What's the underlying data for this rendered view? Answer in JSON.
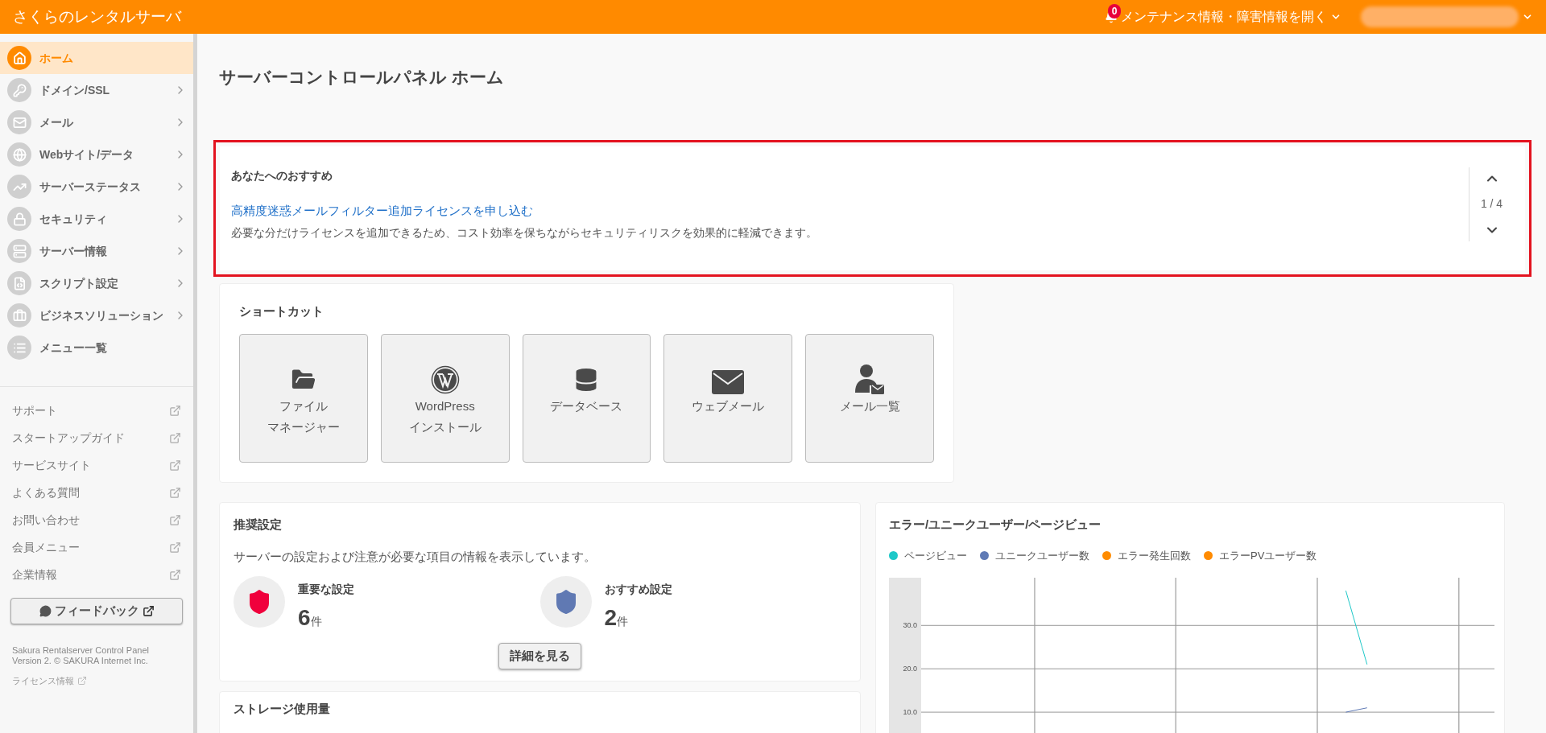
{
  "header": {
    "logo": "さくらのレンタルサーバ",
    "notifications": {
      "count": "0",
      "label": "メンテナンス情報・障害情報を開く"
    }
  },
  "sidebar": {
    "nav": [
      {
        "label": "ホーム",
        "kind": "home",
        "selected": true,
        "has_submenu": false
      },
      {
        "label": "ドメイン/SSL",
        "kind": "lock-www",
        "selected": false,
        "has_submenu": true
      },
      {
        "label": "メール",
        "kind": "mail",
        "selected": false,
        "has_submenu": true
      },
      {
        "label": "Webサイト/データ",
        "kind": "globe",
        "selected": false,
        "has_submenu": true
      },
      {
        "label": "サーバーステータス",
        "kind": "chart",
        "selected": false,
        "has_submenu": true
      },
      {
        "label": "セキュリティ",
        "kind": "lock",
        "selected": false,
        "has_submenu": true
      },
      {
        "label": "サーバー情報",
        "kind": "server",
        "selected": false,
        "has_submenu": true
      },
      {
        "label": "スクリプト設定",
        "kind": "file-code",
        "selected": false,
        "has_submenu": true
      },
      {
        "label": "ビジネスソリューション",
        "kind": "briefcase",
        "selected": false,
        "has_submenu": true
      },
      {
        "label": "メニュー一覧",
        "kind": "list",
        "selected": false,
        "has_submenu": false
      }
    ],
    "links": [
      "サポート",
      "スタートアップガイド",
      "サービスサイト",
      "よくある質問",
      "お問い合わせ",
      "会員メニュー",
      "企業情報"
    ],
    "feedback": "フィードバック",
    "footer": [
      "Sakura Rentalserver Control Panel",
      "Version 2. © SAKURA Internet Inc."
    ],
    "license_link": "ライセンス情報"
  },
  "page_title": "サーバーコントロールパネル ホーム",
  "recommendation": {
    "heading": "あなたへのおすすめ",
    "link": "高精度迷惑メールフィルター追加ライセンスを申し込む",
    "description": "必要な分だけライセンスを追加できるため、コスト効率を保ちながらセキュリティリスクを効果的に軽減できます。",
    "pager": "1 / 4"
  },
  "shortcuts": {
    "title": "ショートカット",
    "items": [
      {
        "kind": "folder",
        "lines": [
          "ファイル",
          "マネージャー"
        ]
      },
      {
        "kind": "wordpress",
        "lines": [
          "WordPress",
          "インストール"
        ]
      },
      {
        "kind": "database",
        "lines": [
          "データベース"
        ]
      },
      {
        "kind": "mail",
        "lines": [
          "ウェブメール"
        ]
      },
      {
        "kind": "user-mail",
        "lines": [
          "メール一覧"
        ]
      }
    ]
  },
  "recommended_settings": {
    "title": "推奨設定",
    "description": "サーバーの設定および注意が必要な項目の情報を表示しています。",
    "items": [
      {
        "kind": "important",
        "label": "重要な設定",
        "count": "6",
        "unit": "件"
      },
      {
        "kind": "suggested",
        "label": "おすすめ設定",
        "count": "2",
        "unit": "件"
      }
    ],
    "button": "詳細を見る"
  },
  "chart_panel": {
    "title": "エラー/ユニークユーザー/ページビュー",
    "legend": [
      {
        "name": "ページビュー",
        "color": "#1ec8c8"
      },
      {
        "name": "ユニークユーザー数",
        "color": "#5f7ab5"
      },
      {
        "name": "エラー発生回数",
        "color": "#ff8c00"
      },
      {
        "name": "エラーPVユーザー数",
        "color": "#ff8b01"
      }
    ],
    "chart_data": {
      "type": "line",
      "grid": true,
      "ylim": [
        0,
        41
      ],
      "yticks": [
        {
          "value": 10,
          "label": "10.0"
        },
        {
          "value": 20,
          "label": "20.0"
        },
        {
          "value": 30,
          "label": "30.0"
        }
      ],
      "series": [
        {
          "color": "#1ec8c8",
          "values": [
            null,
            null,
            null,
            null,
            null,
            null,
            null,
            null,
            null,
            null,
            null,
            null,
            null,
            null,
            null,
            null,
            null,
            null,
            null,
            null,
            38,
            21,
            null,
            null,
            null,
            null,
            null,
            null
          ]
        },
        {
          "color": "#5f7ab5",
          "values": [
            null,
            null,
            null,
            null,
            null,
            null,
            null,
            null,
            null,
            null,
            null,
            null,
            null,
            null,
            null,
            null,
            null,
            null,
            null,
            null,
            10,
            11,
            null,
            null,
            null,
            null,
            null,
            null
          ]
        }
      ]
    }
  },
  "storage": {
    "title": "ストレージ使用量"
  }
}
